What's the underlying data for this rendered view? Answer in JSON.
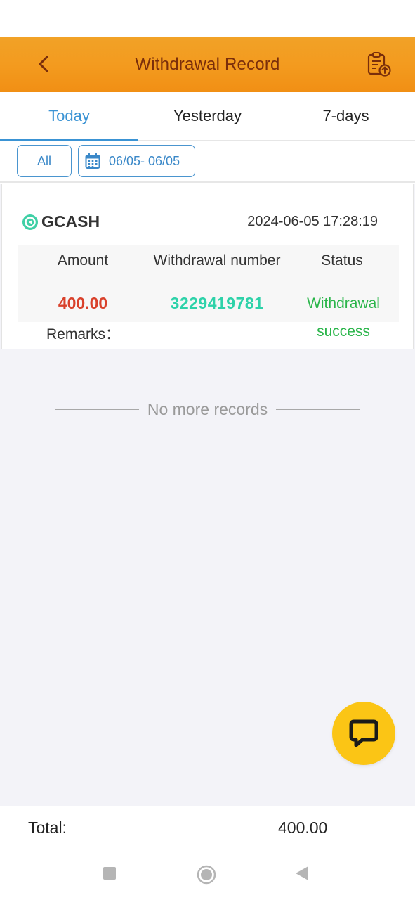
{
  "header": {
    "title": "Withdrawal Record",
    "back_icon": "chevron-left-icon",
    "export_icon": "clipboard-upload-icon"
  },
  "tabs": [
    {
      "label": "Today",
      "active": true
    },
    {
      "label": "Yesterday",
      "active": false
    },
    {
      "label": "7-days",
      "active": false
    }
  ],
  "filters": {
    "all_label": "All",
    "date_range": "06/05- 06/05",
    "calendar_icon": "calendar-icon"
  },
  "record": {
    "method": "GCASH",
    "method_icon": "gcash-logo-icon",
    "datetime": "2024-06-05 17:28:19",
    "headers": {
      "amount": "Amount",
      "number": "Withdrawal number",
      "status": "Status"
    },
    "amount": "400.00",
    "number": "3229419781",
    "status_line1": "Withdrawal",
    "status_line2": "success",
    "remarks_label": "Remarks："
  },
  "no_more_text": "No more records",
  "chat_icon": "chat-bubble-icon",
  "total": {
    "label": "Total:",
    "value": "400.00"
  },
  "colors": {
    "header_orange": "#f39a1e",
    "title_brown": "#7a2e0b",
    "accent_blue": "#3a93d4",
    "amount_red": "#d9412b",
    "number_teal": "#2ed2a9",
    "status_green": "#2ab54a",
    "fab_yellow": "#fbc515"
  }
}
